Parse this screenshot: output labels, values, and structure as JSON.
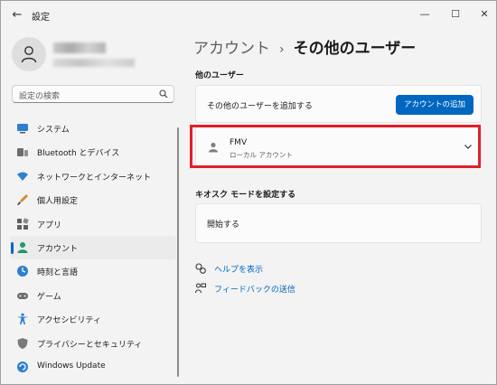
{
  "window": {
    "title": "設定",
    "back_glyph": "←",
    "min_glyph": "—",
    "max_glyph": "☐",
    "close_glyph": "✕"
  },
  "search": {
    "placeholder": "設定の検索",
    "icon": "search-icon"
  },
  "nav": {
    "items": [
      {
        "label": "システム",
        "icon": "monitor-icon",
        "active": false
      },
      {
        "label": "Bluetooth とデバイス",
        "icon": "bluetooth-devices-icon",
        "active": false
      },
      {
        "label": "ネットワークとインターネット",
        "icon": "wifi-icon",
        "active": false
      },
      {
        "label": "個人用設定",
        "icon": "paintbrush-icon",
        "active": false
      },
      {
        "label": "アプリ",
        "icon": "apps-icon",
        "active": false
      },
      {
        "label": "アカウント",
        "icon": "account-icon",
        "active": true
      },
      {
        "label": "時刻と言語",
        "icon": "globe-clock-icon",
        "active": false
      },
      {
        "label": "ゲーム",
        "icon": "gamepad-icon",
        "active": false
      },
      {
        "label": "アクセシビリティ",
        "icon": "accessibility-icon",
        "active": false
      },
      {
        "label": "プライバシーとセキュリティ",
        "icon": "shield-icon",
        "active": false
      },
      {
        "label": "Windows Update",
        "icon": "update-icon",
        "active": false
      }
    ]
  },
  "breadcrumb": {
    "parent": "アカウント",
    "separator": "›",
    "current": "その他のユーザー"
  },
  "other_users": {
    "heading": "他のユーザー",
    "add_row_label": "その他のユーザーを追加する",
    "add_button": "アカウントの追加",
    "user": {
      "name": "FMV",
      "type": "ローカル アカウント"
    }
  },
  "kiosk": {
    "heading": "キオスク モードを設定する",
    "start_label": "開始する"
  },
  "links": {
    "help": "ヘルプを表示",
    "feedback": "フィードバックの送信"
  },
  "colors": {
    "accent": "#0067c0",
    "highlight_border": "#e0202c",
    "background": "#f3f3f3",
    "card": "#fbfbfb"
  }
}
